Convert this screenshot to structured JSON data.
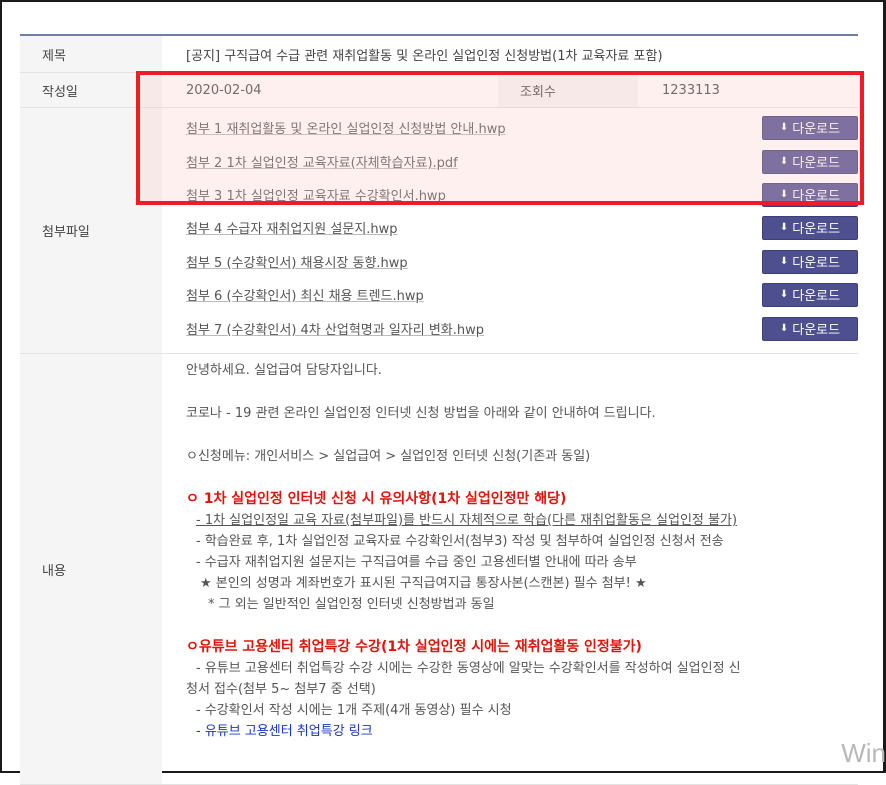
{
  "labels": {
    "title": "제목",
    "date": "작성일",
    "views": "조회수",
    "attachments": "첨부파일",
    "content": "내용"
  },
  "post": {
    "title": "[공지] 구직급여 수급 관련 재취업활동 및 온라인 실업인정 신청방법(1차 교육자료 포함)",
    "date": "2020-02-04",
    "views": "1233113"
  },
  "download_label": "다운로드",
  "attachments": [
    "첨부 1 재취업활동 및 온라인 실업인정 신청방법 안내.hwp",
    "첨부 2 1차 실업인정 교육자료(자체학습자료).pdf",
    "첨부 3 1차 실업인정 교육자료 수강확인서.hwp",
    "첨부 4 수급자 재취업지원 설문지.hwp",
    "첨부 5 (수강확인서) 채용시장 동향.hwp",
    "첨부 6 (수강확인서) 최신 채용 트렌드.hwp",
    "첨부 7 (수강확인서) 4차 산업혁명과 일자리 변화.hwp"
  ],
  "content": {
    "greeting": "안녕하세요. 실업급여 담당자입니다.",
    "intro": "코로나 - 19 관련 온라인 실업인정 인터넷 신청 방법을 아래와 같이 안내하여 드립니다.",
    "menu": "ㅇ신청메뉴: 개인서비스 > 실업급여 > 실업인정 인터넷 신청(기존과 동일)",
    "section1_title": "ㅇ 1차 실업인정 인터넷 신청 시 유의사항(1차 실업인정만 해당)",
    "section1_lines": [
      "- 1차 실업인정일 교육 자료(첨부파일)를 반드시 자체적으로 학습(다른 재취업활동은 실업인정 불가)",
      "- 학습완료 후, 1차 실업인정 교육자료 수강확인서(첨부3) 작성 및 첨부하여 실업인정 신청서 전송",
      "- 수급자 재취업지원 설문지는 구직급여를 수급 중인 고용센터별 안내에 따라 송부",
      "★ 본인의 성명과 계좌번호가 표시된 구직급여지급 통장사본(스캔본) 필수 첨부! ★",
      "* 그 외는 일반적인 실업인정 인터넷 신청방법과 동일"
    ],
    "section2_title": "ㅇ유튜브 고용센터 취업특강 수강(1차 실업인정 시에는 재취업활동 인정불가)",
    "section2_lines": [
      "- 유튜브 고용센터 취업특강 수강 시에는 수강한 동영상에 알맞는 수강확인서를 작성하여 실업인정 신",
      "청서 접수(첨부 5~ 첨부7 중 선택)",
      "- 수강확인서 작성 시에는 1개 주제(4개 동영상) 필수 시청"
    ],
    "youtube_link": "- 유튜브 고용센터 취업특강 링크"
  },
  "watermark": "Win",
  "colors": {
    "button": "#4d4f8f",
    "highlight": "#ee1c25",
    "red_text": "#e0140b",
    "link_blue": "#1a35c8"
  }
}
